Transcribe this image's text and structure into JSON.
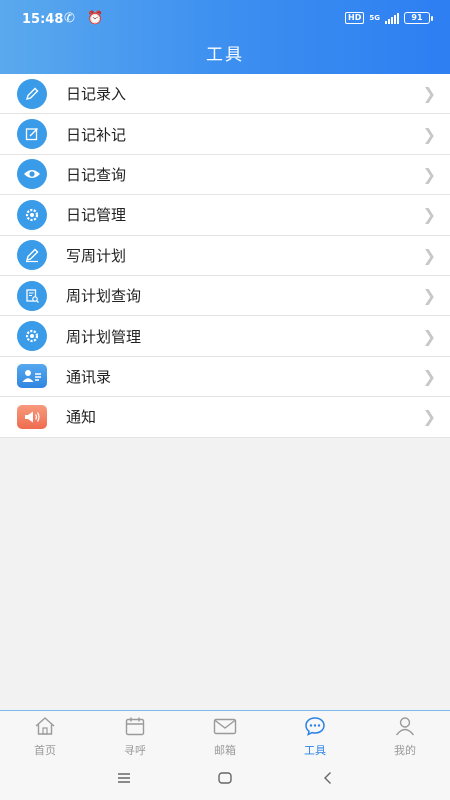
{
  "status_bar": {
    "time": "15:48",
    "left_icons": "✆ ⏰",
    "hd": "HD",
    "network": "5G",
    "battery": "91"
  },
  "header": {
    "title": "工具"
  },
  "menu": [
    {
      "label": "日记录入",
      "icon": "pencil-icon"
    },
    {
      "label": "日记补记",
      "icon": "edit-note-icon"
    },
    {
      "label": "日记查询",
      "icon": "eye-icon"
    },
    {
      "label": "日记管理",
      "icon": "gear-icon"
    },
    {
      "label": "写周计划",
      "icon": "pencil-icon"
    },
    {
      "label": "周计划查询",
      "icon": "document-search-icon"
    },
    {
      "label": "周计划管理",
      "icon": "gear-icon"
    },
    {
      "label": "通讯录",
      "icon": "contacts-icon"
    },
    {
      "label": "通知",
      "icon": "megaphone-icon"
    }
  ],
  "tabbar": {
    "items": [
      {
        "label": "首页",
        "icon": "home-icon",
        "active": false
      },
      {
        "label": "寻呼",
        "icon": "calendar-icon",
        "active": false
      },
      {
        "label": "邮箱",
        "icon": "mail-icon",
        "active": false
      },
      {
        "label": "工具",
        "icon": "chat-bubble-icon",
        "active": true
      },
      {
        "label": "我的",
        "icon": "person-icon",
        "active": false
      }
    ]
  },
  "colors": {
    "header_start": "#5aa9ee",
    "header_end": "#2d7ff2",
    "accent": "#2c83e6",
    "icon_blue": "#3a9be8",
    "notice_red": "#ef6b4f"
  }
}
